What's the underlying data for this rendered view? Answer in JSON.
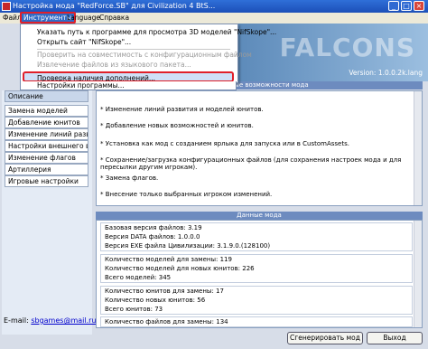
{
  "window": {
    "title": "Настройка мода \"RedForce.SB\" для Civilization 4 BtS...",
    "controls": {
      "minimize": "_",
      "maximize": "□",
      "close": "×"
    }
  },
  "menubar": {
    "items": [
      {
        "label": "Файл"
      },
      {
        "label": "Инструменты"
      },
      {
        "label": "Language"
      },
      {
        "label": "Справка"
      }
    ]
  },
  "dropdown": {
    "items": [
      {
        "label": "Указать путь к программе для просмотра 3D моделей \"NifSkope\"..."
      },
      {
        "label": "Открыть сайт \"NifSkope\"..."
      },
      {
        "label": "Проверить на совместимость с конфигурационным файлом"
      },
      {
        "label": "Извлечение файлов из языкового пакета..."
      },
      {
        "label": "Проверка наличия дополнений..."
      },
      {
        "label": "Настройки программы..."
      }
    ]
  },
  "banner": {
    "logo": "FALCONS",
    "version": "Version: 1.0.0.2k.lang"
  },
  "sidebar": {
    "items": [
      {
        "label": "Описание"
      },
      {
        "label": "Замена моделей"
      },
      {
        "label": "Добавление юнитов"
      },
      {
        "label": "Изменение линий развития"
      },
      {
        "label": "Настройки внешнего вида"
      },
      {
        "label": "Изменение флагов"
      },
      {
        "label": "Артиллерия"
      },
      {
        "label": "Игровые настройки"
      }
    ],
    "email_label": "E-mail:",
    "email": "sbgames@mail.ru"
  },
  "features": {
    "header": "Основные возможности мода",
    "items": [
      "* Изменение линий развития и моделей юнитов.",
      "* Добавление новых возможностей и юнитов.",
      "* Установка как мод с созданием ярлыка для запуска или в CustomAssets.",
      "* Сохранение/загрузка конфигурационных файлов (для сохранения настроек мода и для пересылки другим игрокам).",
      "* Замена флагов.",
      "* Внесение только выбранных игроком изменений."
    ]
  },
  "moddata": {
    "header": "Данные мода",
    "groups": [
      [
        "Базовая версия файлов: 3.19",
        "Версия DATA файлов: 1.0.0.0",
        "Версия EXE файла Цивилизации: 3.1.9.0.(128100)"
      ],
      [
        "Количество моделей для замены: 119",
        "Количество моделей для новых юнитов: 226",
        "Всего моделей: 345"
      ],
      [
        "Количество юнитов для замены: 17",
        "Количество новых юнитов: 56",
        "Всего юнитов: 73"
      ],
      [
        "Количество файлов для замены: 134"
      ]
    ]
  },
  "buttons": {
    "generate": "Сгенерировать мод",
    "exit": "Выход"
  }
}
